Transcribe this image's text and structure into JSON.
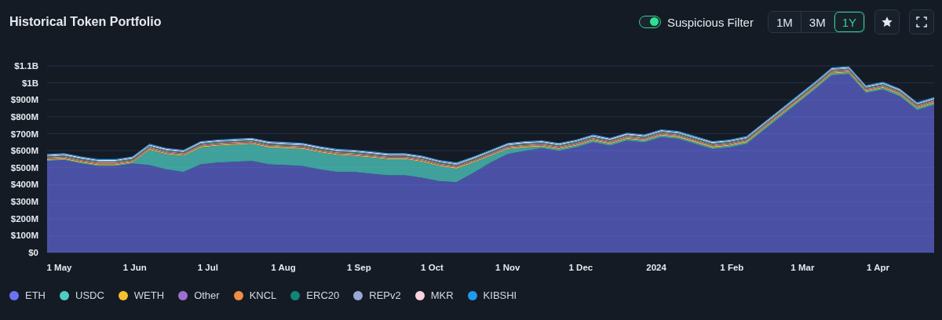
{
  "title": "Historical Token Portfolio",
  "filter": {
    "label": "Suspicious Filter",
    "on": true
  },
  "ranges": [
    {
      "label": "1M",
      "selected": false
    },
    {
      "label": "3M",
      "selected": false
    },
    {
      "label": "1Y",
      "selected": true
    }
  ],
  "chart_data": {
    "type": "area",
    "stacked": true,
    "grid": true,
    "x": [
      "2023-04-26",
      "2023-05-03",
      "2023-05-10",
      "2023-05-17",
      "2023-05-24",
      "2023-05-31",
      "2023-06-07",
      "2023-06-14",
      "2023-06-21",
      "2023-06-28",
      "2023-07-05",
      "2023-07-12",
      "2023-07-19",
      "2023-07-26",
      "2023-08-02",
      "2023-08-09",
      "2023-08-16",
      "2023-08-23",
      "2023-08-30",
      "2023-09-06",
      "2023-09-13",
      "2023-09-20",
      "2023-09-27",
      "2023-10-04",
      "2023-10-11",
      "2023-10-18",
      "2023-10-25",
      "2023-11-01",
      "2023-11-08",
      "2023-11-15",
      "2023-11-22",
      "2023-11-29",
      "2023-12-06",
      "2023-12-13",
      "2023-12-20",
      "2023-12-27",
      "2024-01-03",
      "2024-01-10",
      "2024-01-17",
      "2024-01-24",
      "2024-01-31",
      "2024-02-07",
      "2024-02-14",
      "2024-02-21",
      "2024-02-28",
      "2024-03-06",
      "2024-03-13",
      "2024-03-20",
      "2024-03-27",
      "2024-04-03",
      "2024-04-10",
      "2024-04-17",
      "2024-04-24"
    ],
    "xlim": [
      "2023-04-26",
      "2024-04-24"
    ],
    "ylim": [
      0,
      1100000000
    ],
    "xticks": [
      {
        "value": "2023-05-01",
        "label": "1 May"
      },
      {
        "value": "2023-06-01",
        "label": "1 Jun"
      },
      {
        "value": "2023-07-01",
        "label": "1 Jul"
      },
      {
        "value": "2023-08-01",
        "label": "1 Aug"
      },
      {
        "value": "2023-09-01",
        "label": "1 Sep"
      },
      {
        "value": "2023-10-01",
        "label": "1 Oct"
      },
      {
        "value": "2023-11-01",
        "label": "1 Nov"
      },
      {
        "value": "2023-12-01",
        "label": "1 Dec"
      },
      {
        "value": "2024-01-01",
        "label": "2024"
      },
      {
        "value": "2024-02-01",
        "label": "1 Feb"
      },
      {
        "value": "2024-03-01",
        "label": "1 Mar"
      },
      {
        "value": "2024-04-01",
        "label": "1 Apr"
      }
    ],
    "yticks": [
      {
        "value": 0,
        "label": "$0"
      },
      {
        "value": 100000000,
        "label": "$100M"
      },
      {
        "value": 200000000,
        "label": "$200M"
      },
      {
        "value": 300000000,
        "label": "$300M"
      },
      {
        "value": 400000000,
        "label": "$400M"
      },
      {
        "value": 500000000,
        "label": "$500M"
      },
      {
        "value": 600000000,
        "label": "$600M"
      },
      {
        "value": 700000000,
        "label": "$700M"
      },
      {
        "value": 800000000,
        "label": "$800M"
      },
      {
        "value": 900000000,
        "label": "$900M"
      },
      {
        "value": 1000000000,
        "label": "$1B"
      },
      {
        "value": 1100000000,
        "label": "$1.1B"
      }
    ],
    "series": [
      {
        "name": "ETH",
        "color": "#6c72f5",
        "values": [
          540000000,
          545000000,
          525000000,
          510000000,
          510000000,
          525000000,
          515000000,
          490000000,
          475000000,
          520000000,
          530000000,
          535000000,
          540000000,
          520000000,
          515000000,
          510000000,
          490000000,
          475000000,
          475000000,
          465000000,
          455000000,
          455000000,
          440000000,
          420000000,
          415000000,
          470000000,
          530000000,
          580000000,
          600000000,
          615000000,
          600000000,
          620000000,
          650000000,
          630000000,
          660000000,
          650000000,
          680000000,
          670000000,
          640000000,
          610000000,
          620000000,
          640000000,
          720000000,
          800000000,
          880000000,
          960000000,
          1045000000,
          1052000000,
          940000000,
          960000000,
          920000000,
          840000000,
          870000000
        ]
      },
      {
        "name": "USDC",
        "color": "#4ecdc4",
        "values": [
          5000000,
          5000000,
          5000000,
          5000000,
          5000000,
          5000000,
          90000000,
          90000000,
          95000000,
          100000000,
          100000000,
          100000000,
          100000000,
          100000000,
          100000000,
          100000000,
          100000000,
          100000000,
          95000000,
          95000000,
          95000000,
          95000000,
          95000000,
          90000000,
          80000000,
          60000000,
          40000000,
          30000000,
          20000000,
          10000000,
          10000000,
          10000000,
          10000000,
          10000000,
          10000000,
          10000000,
          10000000,
          10000000,
          10000000,
          10000000,
          10000000,
          10000000,
          10000000,
          10000000,
          10000000,
          10000000,
          10000000,
          10000000,
          10000000,
          10000000,
          10000000,
          10000000,
          10000000
        ]
      },
      {
        "name": "WETH",
        "color": "#f5c02e",
        "values": [
          6000000,
          6000000,
          6000000,
          6000000,
          6000000,
          6000000,
          6000000,
          6000000,
          6000000,
          6000000,
          6000000,
          6000000,
          6000000,
          6000000,
          6000000,
          6000000,
          6000000,
          6000000,
          6000000,
          6000000,
          6000000,
          6000000,
          6000000,
          6000000,
          6000000,
          6000000,
          6000000,
          6000000,
          6000000,
          6000000,
          6000000,
          6000000,
          6000000,
          6000000,
          6000000,
          6000000,
          6000000,
          6000000,
          6000000,
          6000000,
          6000000,
          6000000,
          6000000,
          6000000,
          6000000,
          6000000,
          6000000,
          6000000,
          6000000,
          6000000,
          6000000,
          6000000,
          6000000
        ]
      },
      {
        "name": "Other",
        "color": "#9b6fd1",
        "values": [
          5000000,
          5000000,
          5000000,
          5000000,
          5000000,
          5000000,
          5000000,
          5000000,
          5000000,
          5000000,
          5000000,
          5000000,
          5000000,
          5000000,
          5000000,
          5000000,
          5000000,
          5000000,
          5000000,
          5000000,
          5000000,
          5000000,
          5000000,
          5000000,
          5000000,
          5000000,
          5000000,
          5000000,
          5000000,
          5000000,
          5000000,
          5000000,
          5000000,
          5000000,
          5000000,
          5000000,
          5000000,
          5000000,
          5000000,
          5000000,
          5000000,
          5000000,
          5000000,
          5000000,
          5000000,
          5000000,
          5000000,
          5000000,
          5000000,
          5000000,
          5000000,
          5000000,
          5000000
        ]
      },
      {
        "name": "KNCL",
        "color": "#f28c45",
        "values": [
          5000000,
          5000000,
          5000000,
          5000000,
          5000000,
          5000000,
          5000000,
          5000000,
          5000000,
          5000000,
          5000000,
          5000000,
          5000000,
          5000000,
          5000000,
          5000000,
          5000000,
          5000000,
          5000000,
          5000000,
          5000000,
          5000000,
          5000000,
          5000000,
          5000000,
          5000000,
          5000000,
          5000000,
          5000000,
          5000000,
          5000000,
          5000000,
          5000000,
          5000000,
          5000000,
          5000000,
          5000000,
          5000000,
          5000000,
          5000000,
          5000000,
          5000000,
          5000000,
          5000000,
          5000000,
          5000000,
          5000000,
          5000000,
          5000000,
          5000000,
          5000000,
          5000000,
          5000000
        ]
      },
      {
        "name": "ERC20",
        "color": "#11857a",
        "values": [
          5000000,
          5000000,
          5000000,
          5000000,
          5000000,
          5000000,
          5000000,
          5000000,
          5000000,
          5000000,
          5000000,
          5000000,
          5000000,
          5000000,
          5000000,
          5000000,
          5000000,
          5000000,
          5000000,
          5000000,
          5000000,
          5000000,
          5000000,
          5000000,
          5000000,
          5000000,
          5000000,
          5000000,
          5000000,
          5000000,
          5000000,
          5000000,
          5000000,
          5000000,
          5000000,
          5000000,
          5000000,
          5000000,
          5000000,
          5000000,
          5000000,
          5000000,
          5000000,
          5000000,
          5000000,
          5000000,
          5000000,
          5000000,
          5000000,
          5000000,
          5000000,
          5000000,
          5000000
        ]
      },
      {
        "name": "REPv2",
        "color": "#9aa8d6",
        "values": [
          5000000,
          5000000,
          5000000,
          5000000,
          5000000,
          5000000,
          5000000,
          5000000,
          5000000,
          5000000,
          5000000,
          5000000,
          5000000,
          5000000,
          5000000,
          5000000,
          5000000,
          5000000,
          5000000,
          5000000,
          5000000,
          5000000,
          5000000,
          5000000,
          5000000,
          5000000,
          5000000,
          5000000,
          5000000,
          5000000,
          5000000,
          5000000,
          5000000,
          5000000,
          5000000,
          5000000,
          5000000,
          5000000,
          5000000,
          5000000,
          5000000,
          5000000,
          5000000,
          5000000,
          5000000,
          5000000,
          5000000,
          5000000,
          5000000,
          5000000,
          5000000,
          5000000,
          5000000
        ]
      },
      {
        "name": "MKR",
        "color": "#f9d3e0",
        "values": [
          5000000,
          5000000,
          5000000,
          5000000,
          5000000,
          5000000,
          5000000,
          5000000,
          5000000,
          5000000,
          5000000,
          5000000,
          5000000,
          5000000,
          5000000,
          5000000,
          5000000,
          5000000,
          5000000,
          5000000,
          5000000,
          5000000,
          5000000,
          5000000,
          5000000,
          5000000,
          5000000,
          5000000,
          5000000,
          5000000,
          5000000,
          5000000,
          5000000,
          5000000,
          5000000,
          5000000,
          5000000,
          5000000,
          5000000,
          5000000,
          5000000,
          5000000,
          5000000,
          5000000,
          5000000,
          5000000,
          5000000,
          5000000,
          5000000,
          5000000,
          5000000,
          5000000,
          5000000
        ]
      },
      {
        "name": "KIBSHI",
        "color": "#1e9bf0",
        "values": [
          5000000,
          5000000,
          5000000,
          5000000,
          5000000,
          5000000,
          5000000,
          5000000,
          5000000,
          5000000,
          5000000,
          5000000,
          5000000,
          5000000,
          5000000,
          5000000,
          5000000,
          5000000,
          5000000,
          5000000,
          5000000,
          5000000,
          5000000,
          5000000,
          5000000,
          5000000,
          5000000,
          5000000,
          5000000,
          5000000,
          5000000,
          5000000,
          5000000,
          5000000,
          5000000,
          5000000,
          5000000,
          5000000,
          5000000,
          5000000,
          5000000,
          5000000,
          5000000,
          5000000,
          5000000,
          5000000,
          5000000,
          5000000,
          5000000,
          5000000,
          5000000,
          5000000,
          5000000
        ]
      }
    ]
  }
}
